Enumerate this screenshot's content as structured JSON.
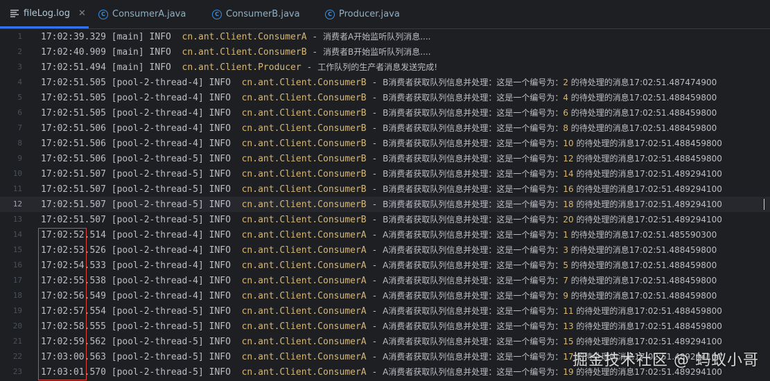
{
  "tabs": [
    {
      "label": "fileLog.log",
      "icon": "log-file-icon",
      "active": true,
      "closable": true
    },
    {
      "label": "ConsumerA.java",
      "icon": "java-class-icon",
      "active": false
    },
    {
      "label": "ConsumerB.java",
      "icon": "java-class-icon",
      "active": false
    },
    {
      "label": "Producer.java",
      "icon": "java-class-icon",
      "active": false
    }
  ],
  "current_line": 12,
  "lines": [
    {
      "n": "1",
      "ts": "17:02:39.329",
      "thread": "[main]",
      "level": "INFO ",
      "cls": "cn.ant.Client.ConsumerA",
      "msg": "消费者A开始监听队列消息...."
    },
    {
      "n": "2",
      "ts": "17:02:40.909",
      "thread": "[main]",
      "level": "INFO ",
      "cls": "cn.ant.Client.ConsumerB",
      "msg": "消费者B开始监听队列消息...."
    },
    {
      "n": "3",
      "ts": "17:02:51.494",
      "thread": "[main]",
      "level": "INFO ",
      "cls": "cn.ant.Client.Producer",
      "msg": "工作队列的生产者消息发送完成!"
    },
    {
      "n": "4",
      "ts": "17:02:51.505",
      "thread": "[pool-2-thread-4]",
      "level": "INFO ",
      "cls": "cn.ant.Client.ConsumerB",
      "msg": "B消费者获取队列信息并处理：这是一个编号为：",
      "id": "2",
      "tail": " 的待处理的消息17:02:51.487474900"
    },
    {
      "n": "5",
      "ts": "17:02:51.505",
      "thread": "[pool-2-thread-4]",
      "level": "INFO ",
      "cls": "cn.ant.Client.ConsumerB",
      "msg": "B消费者获取队列信息并处理：这是一个编号为：",
      "id": "4",
      "tail": " 的待处理的消息17:02:51.488459800"
    },
    {
      "n": "6",
      "ts": "17:02:51.505",
      "thread": "[pool-2-thread-4]",
      "level": "INFO ",
      "cls": "cn.ant.Client.ConsumerB",
      "msg": "B消费者获取队列信息并处理：这是一个编号为：",
      "id": "6",
      "tail": " 的待处理的消息17:02:51.488459800"
    },
    {
      "n": "7",
      "ts": "17:02:51.506",
      "thread": "[pool-2-thread-4]",
      "level": "INFO ",
      "cls": "cn.ant.Client.ConsumerB",
      "msg": "B消费者获取队列信息并处理：这是一个编号为：",
      "id": "8",
      "tail": " 的待处理的消息17:02:51.488459800"
    },
    {
      "n": "8",
      "ts": "17:02:51.506",
      "thread": "[pool-2-thread-4]",
      "level": "INFO ",
      "cls": "cn.ant.Client.ConsumerB",
      "msg": "B消费者获取队列信息并处理：这是一个编号为：",
      "id": "10",
      "tail": " 的待处理的消息17:02:51.488459800"
    },
    {
      "n": "9",
      "ts": "17:02:51.506",
      "thread": "[pool-2-thread-5]",
      "level": "INFO ",
      "cls": "cn.ant.Client.ConsumerB",
      "msg": "B消费者获取队列信息并处理：这是一个编号为：",
      "id": "12",
      "tail": " 的待处理的消息17:02:51.488459800"
    },
    {
      "n": "10",
      "ts": "17:02:51.507",
      "thread": "[pool-2-thread-5]",
      "level": "INFO ",
      "cls": "cn.ant.Client.ConsumerB",
      "msg": "B消费者获取队列信息并处理：这是一个编号为：",
      "id": "14",
      "tail": " 的待处理的消息17:02:51.489294100"
    },
    {
      "n": "11",
      "ts": "17:02:51.507",
      "thread": "[pool-2-thread-5]",
      "level": "INFO ",
      "cls": "cn.ant.Client.ConsumerB",
      "msg": "B消费者获取队列信息并处理：这是一个编号为：",
      "id": "16",
      "tail": " 的待处理的消息17:02:51.489294100"
    },
    {
      "n": "12",
      "ts": "17:02:51.507",
      "thread": "[pool-2-thread-5]",
      "level": "INFO ",
      "cls": "cn.ant.Client.ConsumerB",
      "msg": "B消费者获取队列信息并处理：这是一个编号为：",
      "id": "18",
      "tail": " 的待处理的消息17:02:51.489294100"
    },
    {
      "n": "13",
      "ts": "17:02:51.507",
      "thread": "[pool-2-thread-5]",
      "level": "INFO ",
      "cls": "cn.ant.Client.ConsumerB",
      "msg": "B消费者获取队列信息并处理：这是一个编号为：",
      "id": "20",
      "tail": " 的待处理的消息17:02:51.489294100"
    },
    {
      "n": "14",
      "ts": "17:02:52.514",
      "thread": "[pool-2-thread-4]",
      "level": "INFO ",
      "cls": "cn.ant.Client.ConsumerA",
      "msg": "A消费者获取队列信息并处理：这是一个编号为：",
      "id": "1",
      "tail": " 的待处理的消息17:02:51.485590300"
    },
    {
      "n": "15",
      "ts": "17:02:53.526",
      "thread": "[pool-2-thread-4]",
      "level": "INFO ",
      "cls": "cn.ant.Client.ConsumerA",
      "msg": "A消费者获取队列信息并处理：这是一个编号为：",
      "id": "3",
      "tail": " 的待处理的消息17:02:51.488459800"
    },
    {
      "n": "16",
      "ts": "17:02:54.533",
      "thread": "[pool-2-thread-4]",
      "level": "INFO ",
      "cls": "cn.ant.Client.ConsumerA",
      "msg": "A消费者获取队列信息并处理：这是一个编号为：",
      "id": "5",
      "tail": " 的待处理的消息17:02:51.488459800"
    },
    {
      "n": "17",
      "ts": "17:02:55.538",
      "thread": "[pool-2-thread-4]",
      "level": "INFO ",
      "cls": "cn.ant.Client.ConsumerA",
      "msg": "A消费者获取队列信息并处理：这是一个编号为：",
      "id": "7",
      "tail": " 的待处理的消息17:02:51.488459800"
    },
    {
      "n": "18",
      "ts": "17:02:56.549",
      "thread": "[pool-2-thread-4]",
      "level": "INFO ",
      "cls": "cn.ant.Client.ConsumerA",
      "msg": "A消费者获取队列信息并处理：这是一个编号为：",
      "id": "9",
      "tail": " 的待处理的消息17:02:51.488459800"
    },
    {
      "n": "19",
      "ts": "17:02:57.554",
      "thread": "[pool-2-thread-5]",
      "level": "INFO ",
      "cls": "cn.ant.Client.ConsumerA",
      "msg": "A消费者获取队列信息并处理：这是一个编号为：",
      "id": "11",
      "tail": " 的待处理的消息17:02:51.488459800"
    },
    {
      "n": "20",
      "ts": "17:02:58.555",
      "thread": "[pool-2-thread-5]",
      "level": "INFO ",
      "cls": "cn.ant.Client.ConsumerA",
      "msg": "A消费者获取队列信息并处理：这是一个编号为：",
      "id": "13",
      "tail": " 的待处理的消息17:02:51.488459800"
    },
    {
      "n": "21",
      "ts": "17:02:59.562",
      "thread": "[pool-2-thread-5]",
      "level": "INFO ",
      "cls": "cn.ant.Client.ConsumerA",
      "msg": "A消费者获取队列信息并处理：这是一个编号为：",
      "id": "15",
      "tail": " 的待处理的消息17:02:51.489294100"
    },
    {
      "n": "22",
      "ts": "17:03:00.563",
      "thread": "[pool-2-thread-5]",
      "level": "INFO ",
      "cls": "cn.ant.Client.ConsumerA",
      "msg": "A消费者获取队列信息并处理：这是一个编号为：",
      "id": "17",
      "tail": " 的待处理的消息17:02:51.489294100"
    },
    {
      "n": "23",
      "ts": "17:03:01.570",
      "thread": "[pool-2-thread-5]",
      "level": "INFO ",
      "cls": "cn.ant.Client.ConsumerA",
      "msg": "A消费者获取队列信息并处理：这是一个编号为：",
      "id": "19",
      "tail": " 的待处理的消息17:02:51.489294100"
    }
  ],
  "watermark": "掘金技术社区 @ 蚂蚁小哥",
  "colors": {
    "background": "#1e1f22",
    "text": "#bcbec4",
    "class_name": "#d5b778",
    "number": "#d5b778",
    "active_tab_underline": "#3574f0",
    "highlight_box": "#e0453a"
  }
}
